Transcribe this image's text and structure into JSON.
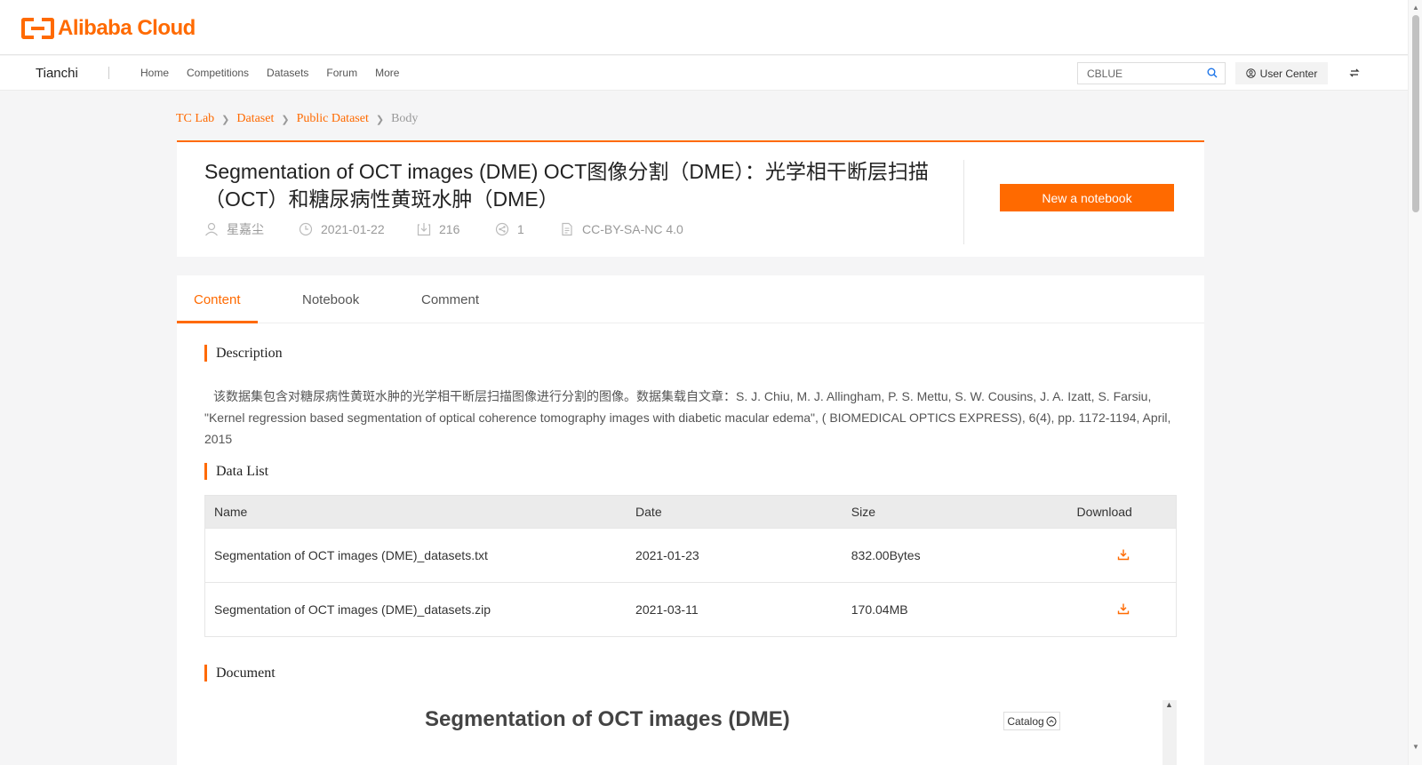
{
  "brand": {
    "logo_text": "Alibaba Cloud",
    "accent": "#ff6a00"
  },
  "nav": {
    "brand": "Tianchi",
    "links": [
      "Home",
      "Competitions",
      "Datasets",
      "Forum",
      "More"
    ],
    "search_value": "CBLUE",
    "user_center": "User Center"
  },
  "breadcrumb": [
    "TC Lab",
    "Dataset",
    "Public Dataset",
    "Body"
  ],
  "dataset": {
    "title": "Segmentation of OCT images (DME) OCT图像分割（DME）：光学相干断层扫描（OCT）和糖尿病性黄斑水肿（DME）",
    "author": "星嘉尘",
    "date": "2021-01-22",
    "downloads": "216",
    "shares": "1",
    "license": "CC-BY-SA-NC 4.0",
    "new_notebook": "New a notebook"
  },
  "tabs": [
    "Content",
    "Notebook",
    "Comment"
  ],
  "sections": {
    "description_title": "Description",
    "description_text": "该数据集包含对糖尿病性黄斑水肿的光学相干断层扫描图像进行分割的图像。数据集载自文章：S. J. Chiu, M. J. Allingham, P. S. Mettu, S. W. Cousins, J. A. Izatt, S. Farsiu, \"Kernel regression based segmentation of optical coherence tomography images with diabetic macular edema\", ( BIOMEDICAL OPTICS EXPRESS), 6(4), pp. 1172-1194, April, 2015",
    "data_list_title": "Data List",
    "document_title": "Document"
  },
  "table": {
    "headers": [
      "Name",
      "Date",
      "Size",
      "Download"
    ],
    "rows": [
      {
        "name": "Segmentation of OCT images (DME)_datasets.txt",
        "date": "2021-01-23",
        "size": "832.00Bytes"
      },
      {
        "name": "Segmentation of OCT images (DME)_datasets.zip",
        "date": "2021-03-11",
        "size": "170.04MB"
      }
    ]
  },
  "document": {
    "heading": "Segmentation of OCT images (DME)",
    "catalog": "Catalog"
  }
}
